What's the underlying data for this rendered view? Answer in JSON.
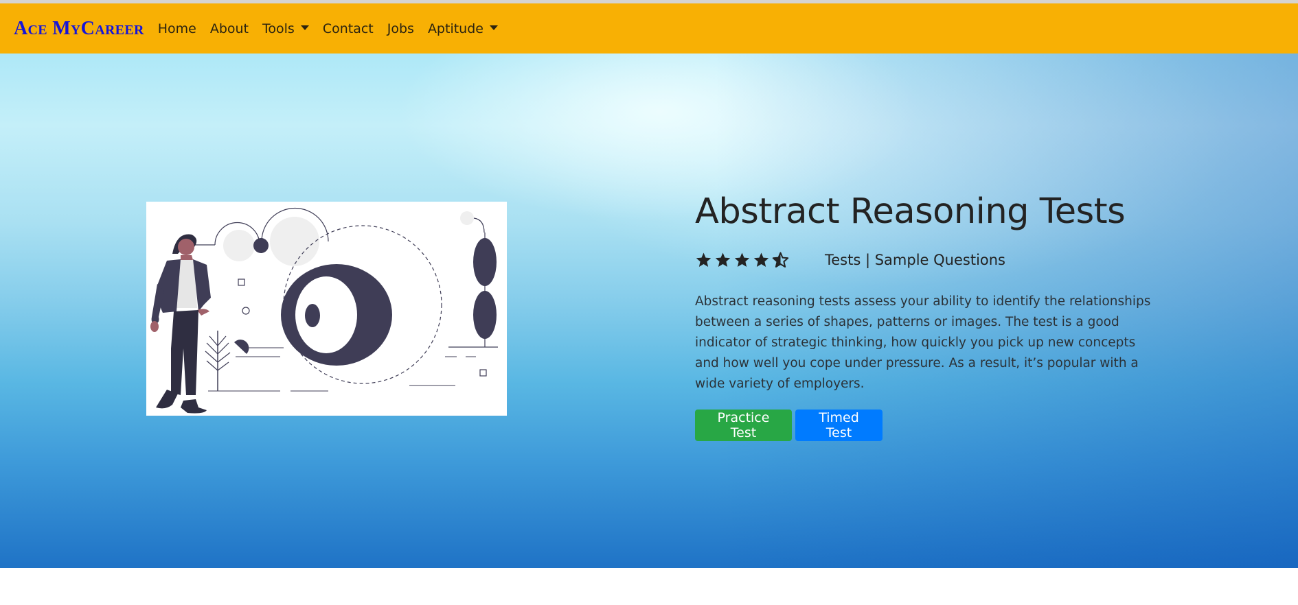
{
  "nav": {
    "brand": "Ace MyCareer",
    "links": [
      "Home",
      "About",
      "Tools",
      "Contact",
      "Jobs",
      "Aptitude"
    ]
  },
  "hero": {
    "title": "Abstract Reasoning Tests",
    "rating": 4.5,
    "rating_max": 5,
    "rating_text": "Tests | Sample Questions",
    "description": "Abstract reasoning tests assess your ability to identify the relationships between a series of shapes, patterns or images. The test is a good indicator of strategic thinking, how quickly you pick up new concepts and how well you cope under pressure. As a result, it’s popular with a wide variety of employers.",
    "buttons": {
      "practice": "Practice Test",
      "timed": "Timed Test"
    }
  },
  "colors": {
    "navbar": "#f8b004",
    "brand": "#1515d8",
    "practice_button": "#28a745",
    "timed_button": "#007bff",
    "illustration_dark": "#3f3d56"
  },
  "icons": [
    "star-icon",
    "star-half-icon",
    "caret-down-icon"
  ]
}
